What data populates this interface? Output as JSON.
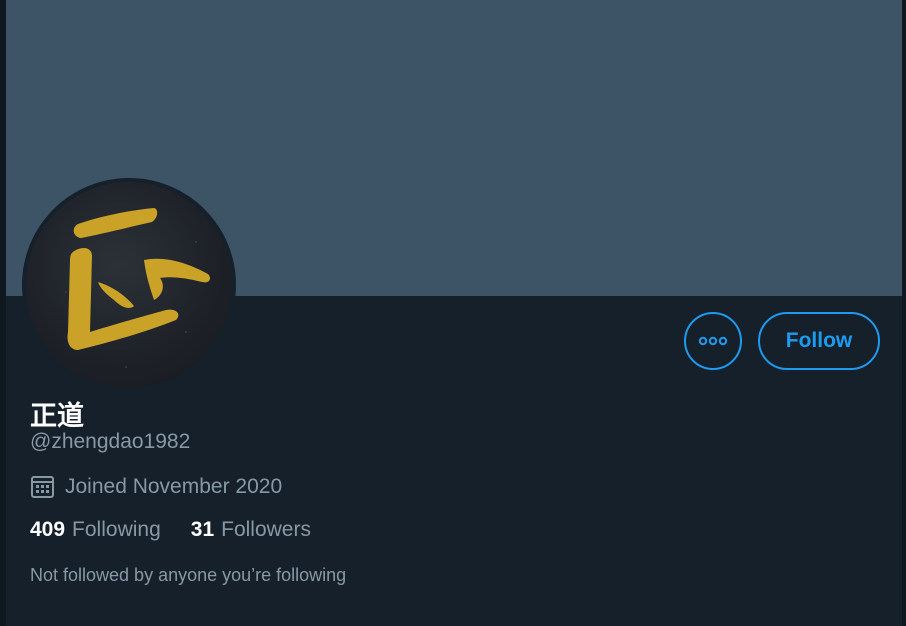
{
  "profile": {
    "display_name": "正道",
    "handle": "@zhengdao1982",
    "joined": "Joined November 2020",
    "following_count": "409",
    "following_label": "Following",
    "followers_count": "31",
    "followers_label": "Followers",
    "social_context": "Not followed by anyone you’re following"
  },
  "actions": {
    "follow_label": "Follow",
    "more_icon": "more-options-icon"
  },
  "icons": {
    "calendar": "calendar-icon"
  },
  "colors": {
    "background": "#15202b",
    "banner": "#3d5466",
    "accent": "#1d9bf0",
    "secondary_text": "#8899a6",
    "avatar_glyph": "#c9a227"
  }
}
